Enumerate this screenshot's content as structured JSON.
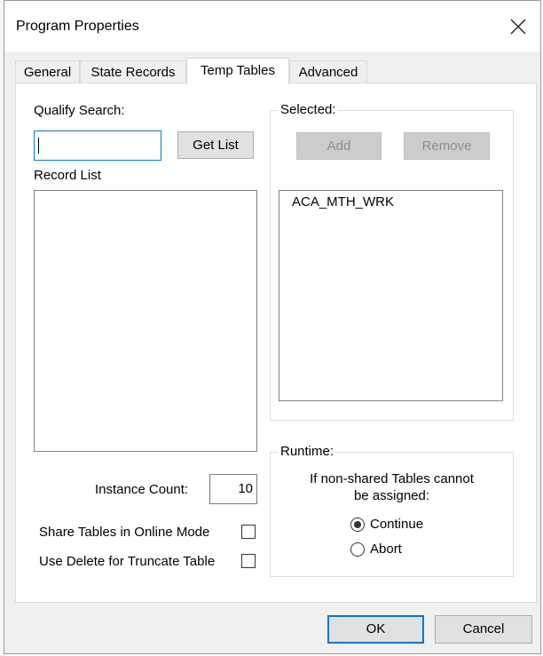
{
  "window": {
    "title": "Program Properties"
  },
  "tabs": [
    {
      "label": "General"
    },
    {
      "label": "State Records"
    },
    {
      "label": "Temp Tables"
    },
    {
      "label": "Advanced"
    }
  ],
  "qualify_search": {
    "label": "Qualify Search:",
    "value": ""
  },
  "get_list_button": {
    "label": "Get List"
  },
  "record_list": {
    "label": "Record List",
    "items": []
  },
  "selected_group": {
    "legend": "Selected:",
    "add_label": "Add",
    "remove_label": "Remove",
    "items": [
      "ACA_MTH_WRK"
    ]
  },
  "instance_count": {
    "label": "Instance Count:",
    "value": "10"
  },
  "share_tables": {
    "label": "Share Tables in Online Mode",
    "checked": false
  },
  "use_delete": {
    "label": "Use Delete for Truncate Table",
    "checked": false
  },
  "runtime_group": {
    "legend": "Runtime:",
    "description_line1": "If non-shared Tables cannot",
    "description_line2": "be assigned:",
    "options": [
      {
        "label": "Continue",
        "selected": true
      },
      {
        "label": "Abort",
        "selected": false
      }
    ]
  },
  "footer": {
    "ok_label": "OK",
    "cancel_label": "Cancel"
  },
  "icons": {
    "close": "close-icon"
  }
}
